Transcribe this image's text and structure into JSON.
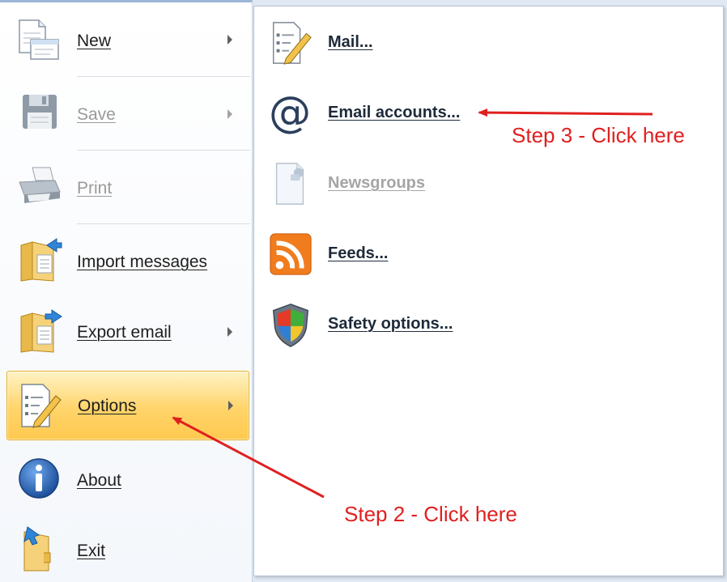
{
  "left_menu": {
    "items": [
      {
        "label": "New",
        "icon": "new-document-icon",
        "submenu": true,
        "disabled": false
      },
      {
        "label": "Save",
        "icon": "floppy-disk-icon",
        "submenu": true,
        "disabled": true
      },
      {
        "label": "Print",
        "icon": "printer-icon",
        "submenu": false,
        "disabled": true
      },
      {
        "label": "Import messages",
        "icon": "import-folder-icon",
        "submenu": false,
        "disabled": false
      },
      {
        "label": "Export email",
        "icon": "export-folder-icon",
        "submenu": true,
        "disabled": false
      },
      {
        "label": "Options",
        "icon": "options-checklist-icon",
        "submenu": true,
        "disabled": false,
        "highlighted": true
      },
      {
        "label": "About",
        "icon": "info-icon",
        "submenu": false,
        "disabled": false
      },
      {
        "label": "Exit",
        "icon": "exit-door-icon",
        "submenu": false,
        "disabled": false
      }
    ]
  },
  "options_submenu": {
    "items": [
      {
        "label": "Mail...",
        "icon": "mail-options-icon",
        "disabled": false
      },
      {
        "label": "Email accounts...",
        "icon": "at-sign-icon",
        "disabled": false
      },
      {
        "label": "Newsgroups",
        "icon": "newsgroups-icon",
        "disabled": true
      },
      {
        "label": "Feeds...",
        "icon": "rss-feed-icon",
        "disabled": false
      },
      {
        "label": "Safety options...",
        "icon": "security-shield-icon",
        "disabled": false
      }
    ]
  },
  "annotations": {
    "step2": "Step 2 - Click here",
    "step3": "Step 3 - Click here"
  },
  "colors": {
    "highlight": "#ffd46a",
    "annotation": "#e02020",
    "rss": "#f07c1e",
    "info": "#1d5fb3"
  }
}
